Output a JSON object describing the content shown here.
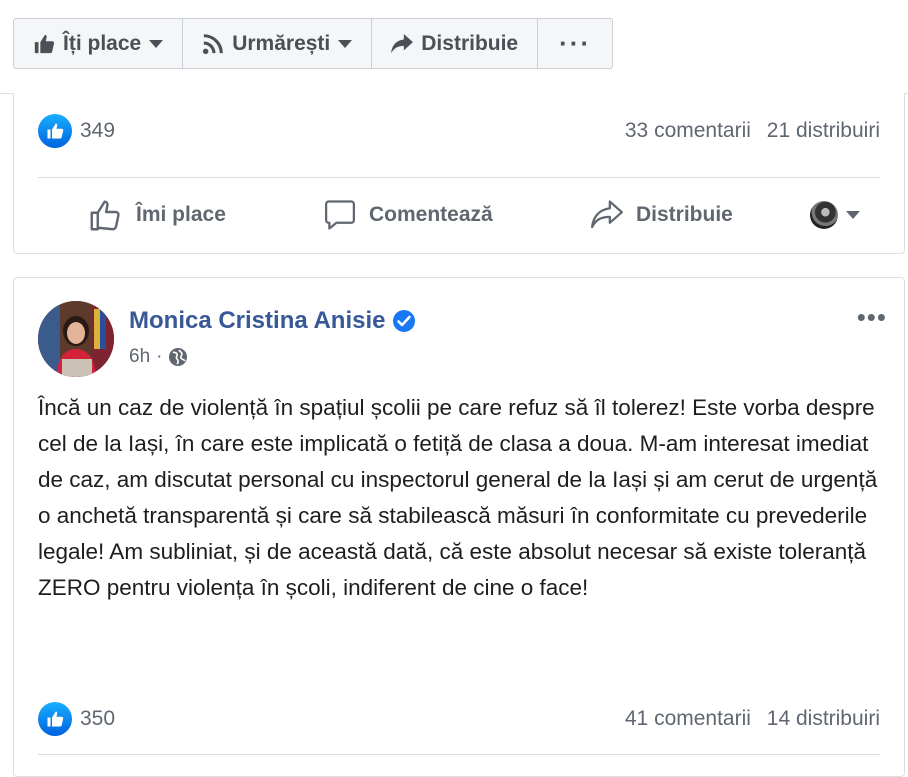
{
  "page_actions": {
    "like_label": "Îți place",
    "follow_label": "Urmărești",
    "share_label": "Distribuie",
    "more_label": "···"
  },
  "post1": {
    "like_count": "349",
    "comments": "33 comentarii",
    "shares": "21 distribuiri",
    "actions": {
      "like": "Îmi place",
      "comment": "Comentează",
      "share": "Distribuie"
    }
  },
  "post2": {
    "author": "Monica Cristina Anisie",
    "time": "6h",
    "separator": "·",
    "more_label": "•••",
    "text": "Încă un caz de violență în spațiul școlii pe care refuz să îl tolerez! Este vorba despre cel de la Iași, în care este implicată o fetiță de clasa a doua. M-am interesat imediat de caz, am discutat personal cu inspectorul general de la Iași și am cerut de urgență o anchetă transparentă și care să stabilească măsuri în conformitate cu prevederile legale! Am subliniat, și de această dată, că este absolut necesar să existe toleranță ZERO pentru violența în școli, indiferent de cine o face!",
    "like_count": "350",
    "comments": "41 comentarii",
    "shares": "14 distribuiri"
  },
  "colors": {
    "brand_link": "#385898",
    "like_blue": "#1877f2",
    "muted": "#606770"
  }
}
